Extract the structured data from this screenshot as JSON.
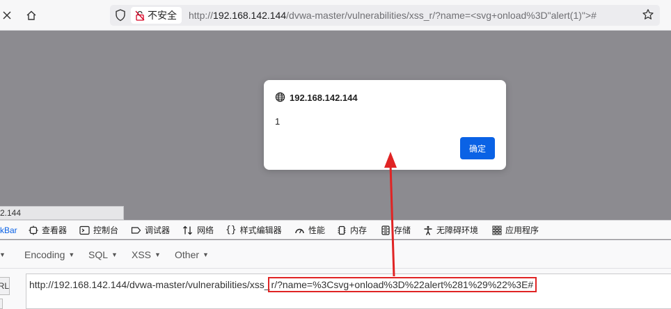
{
  "browser": {
    "security_label": "不安全",
    "url_prefix": "http://",
    "url_host": "192.168.142.144",
    "url_path": "/dvwa-master/vulnerabilities/xss_r/?name=<svg+onload%3D\"alert(1)\">#"
  },
  "dialog": {
    "origin": "192.168.142.144",
    "message": "1",
    "ok_label": "确定"
  },
  "status_link": "2.144",
  "devtools": {
    "tabs": [
      {
        "label": "kBar",
        "icon": "hackbar-icon"
      },
      {
        "label": "查看器",
        "icon": "inspector-icon"
      },
      {
        "label": "控制台",
        "icon": "console-icon"
      },
      {
        "label": "调试器",
        "icon": "debugger-icon"
      },
      {
        "label": "网络",
        "icon": "network-icon"
      },
      {
        "label": "样式编辑器",
        "icon": "style-editor-icon"
      },
      {
        "label": "性能",
        "icon": "performance-icon"
      },
      {
        "label": "内存",
        "icon": "memory-icon"
      },
      {
        "label": "存储",
        "icon": "storage-icon"
      },
      {
        "label": "无障碍环境",
        "icon": "accessibility-icon"
      },
      {
        "label": "应用程序",
        "icon": "application-icon"
      }
    ]
  },
  "hackbar": {
    "menus": [
      "Encoding",
      "SQL",
      "XSS",
      "Other"
    ],
    "field_label": "RL",
    "url_plain": "http://192.168.142.144/dvwa-master/vulnerabilities/xss_",
    "url_highlight": "r/?name=%3Csvg+onload%3D%22alert%281%29%22%3E#"
  },
  "colors": {
    "accent": "#0a62e5",
    "highlight_box": "#e02424",
    "backdrop": "#8c8b90"
  }
}
